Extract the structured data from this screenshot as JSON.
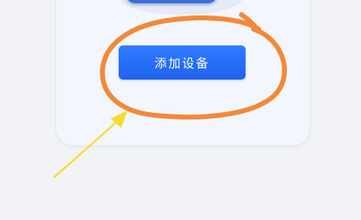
{
  "device_card": {
    "add_device_button_label": "添加设备"
  },
  "annotations": {
    "circle_color": "#f2893a",
    "arrow_color": "#f5dc2a"
  }
}
